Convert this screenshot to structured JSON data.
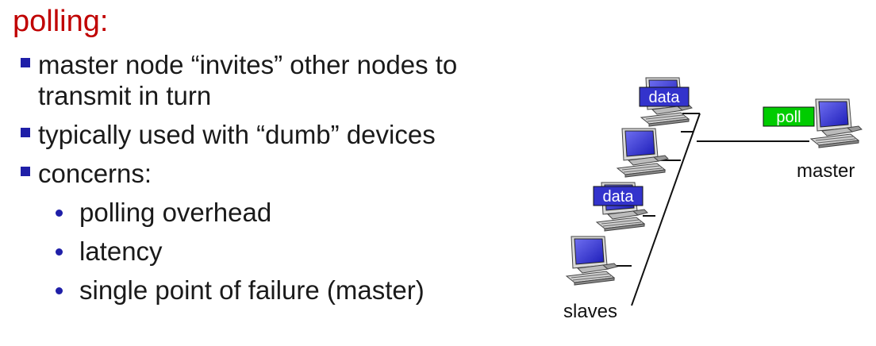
{
  "slide": {
    "title": "polling:"
  },
  "bullets": {
    "items": [
      "master node “invites” other nodes to transmit in turn",
      "typically used with “dumb” devices",
      "concerns:"
    ],
    "sub_items": [
      "polling overhead",
      "latency",
      "single point of failure (master)"
    ]
  },
  "diagram": {
    "tags": {
      "data_1": "data",
      "data_2": "data",
      "poll": "poll"
    },
    "labels": {
      "master": "master",
      "slaves": "slaves"
    },
    "colors": {
      "data_tag": "#3333cc",
      "poll_tag": "#00cc00",
      "screen": "#2b2bd6"
    }
  }
}
